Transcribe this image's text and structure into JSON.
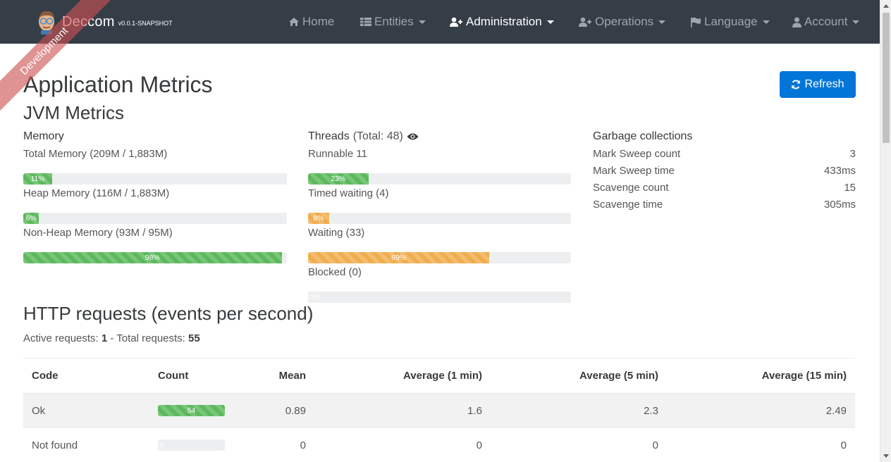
{
  "navbar": {
    "brand_title": "Deccom",
    "brand_version": "v0.0.1-SNAPSHOT",
    "ribbon": "Development",
    "items": [
      {
        "label": "Home",
        "icon": "home-icon"
      },
      {
        "label": "Entities",
        "icon": "table-icon",
        "caret": true
      },
      {
        "label": "Administration",
        "icon": "user-plus-icon",
        "caret": true,
        "active": true
      },
      {
        "label": "Operations",
        "icon": "user-plus-icon",
        "caret": true
      },
      {
        "label": "Language",
        "icon": "flag-icon",
        "caret": true
      },
      {
        "label": "Account",
        "icon": "user-icon",
        "caret": true
      }
    ]
  },
  "page": {
    "title": "Application Metrics",
    "refresh_label": "Refresh",
    "jvm_title": "JVM Metrics"
  },
  "memory": {
    "title": "Memory",
    "total_label": "Total Memory (209M / 1,883M)",
    "total_pct": 11,
    "total_text": "11%",
    "heap_label": "Heap Memory (116M / 1,883M)",
    "heap_pct": 6,
    "heap_text": "6%",
    "nonheap_label": "Non-Heap Memory (93M / 95M)",
    "nonheap_pct": 98,
    "nonheap_text": "98%"
  },
  "threads": {
    "title": "Threads",
    "total": "(Total: 48)",
    "runnable_label": "Runnable 11",
    "runnable_pct": 23,
    "runnable_text": "23%",
    "timed_label": "Timed waiting (4)",
    "timed_pct": 8,
    "timed_text": "8%",
    "waiting_label": "Waiting (33)",
    "waiting_pct": 69,
    "waiting_text": "69%",
    "blocked_label": "Blocked (0)",
    "blocked_pct": 0,
    "blocked_text": "0%"
  },
  "gc": {
    "title": "Garbage collections",
    "rows": [
      {
        "label": "Mark Sweep count",
        "value": "3"
      },
      {
        "label": "Mark Sweep time",
        "value": "433ms"
      },
      {
        "label": "Scavenge count",
        "value": "15"
      },
      {
        "label": "Scavenge time",
        "value": "305ms"
      }
    ]
  },
  "http": {
    "title": "HTTP requests (events per second)",
    "active_prefix": "Active requests:",
    "active_value": "1",
    "total_prefix": "- Total requests:",
    "total_value": "55",
    "columns": [
      "Code",
      "Count",
      "Mean",
      "Average (1 min)",
      "Average (5 min)",
      "Average (15 min)"
    ],
    "rows": [
      {
        "code": "Ok",
        "count": "54",
        "count_pct": 100,
        "mean": "0.89",
        "avg1": "1.6",
        "avg5": "2.3",
        "avg15": "2.49"
      },
      {
        "code": "Not found",
        "count": "0",
        "count_pct": 0,
        "mean": "0",
        "avg1": "0",
        "avg5": "0",
        "avg15": "0"
      }
    ]
  },
  "colors": {
    "navbar": "#353d47",
    "success": "#5cb85c",
    "warning": "#f0ad4e",
    "primary": "#0275d8"
  }
}
